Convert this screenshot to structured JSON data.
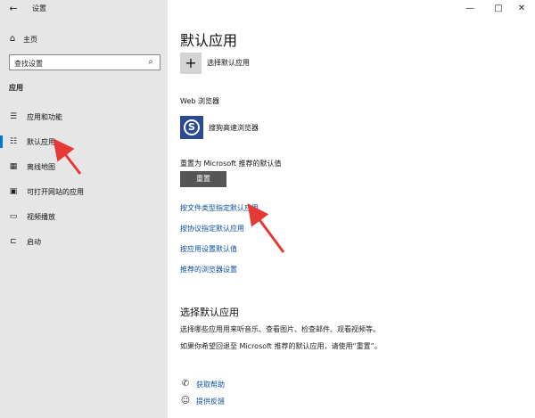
{
  "window": {
    "title": "设置",
    "back_glyph": "←",
    "min_glyph": "—",
    "max_glyph": "□",
    "close_glyph": "✕"
  },
  "sidebar": {
    "home_label": "主页",
    "search_value": "查找设置",
    "section_label": "应用",
    "items": [
      {
        "label": "应用和功能",
        "icon": "apps-list-icon"
      },
      {
        "label": "默认应用",
        "icon": "default-apps-icon",
        "active": true
      },
      {
        "label": "离线地图",
        "icon": "map-icon"
      },
      {
        "label": "可打开网站的应用",
        "icon": "web-apps-icon"
      },
      {
        "label": "视频播放",
        "icon": "video-icon"
      },
      {
        "label": "启动",
        "icon": "startup-icon"
      }
    ]
  },
  "main": {
    "title": "默认应用",
    "choose_app_label": "选择默认应用",
    "web_browser_label": "Web 浏览器",
    "browser_name": "搜狗高速浏览器",
    "reset_label": "重置为 Microsoft 推荐的默认值",
    "reset_button": "重置",
    "links": [
      "按文件类型指定默认应用",
      "按协议指定默认应用",
      "按应用设置默认值",
      "推荐的浏览器设置"
    ],
    "section2_title": "选择默认应用",
    "section2_p1": "选择哪些应用用来听音乐、查看图片、检查邮件、观看视频等。",
    "section2_p2": "如果你希望回退至 Microsoft 推荐的默认应用，请使用“重置”。",
    "help_links": [
      {
        "label": "获取帮助",
        "icon": "help-icon"
      },
      {
        "label": "提供反馈",
        "icon": "feedback-icon"
      }
    ]
  },
  "colors": {
    "accent": "#0078d7",
    "link": "#0a4fa0",
    "annotation_arrow": "#e53935"
  }
}
